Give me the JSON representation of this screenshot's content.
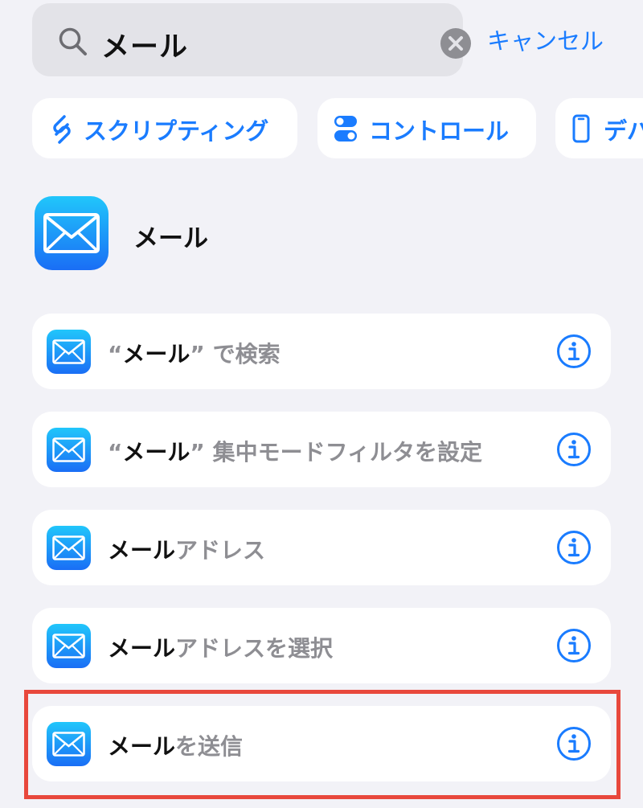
{
  "search": {
    "query": "メール",
    "cancel_label": "キャンセル"
  },
  "categories": [
    {
      "label": "スクリプティング",
      "icon": "scripting-icon"
    },
    {
      "label": "コントロール",
      "icon": "toggle-icon"
    },
    {
      "label": "デバ",
      "icon": "device-icon"
    }
  ],
  "app_header": {
    "title": "メール",
    "icon": "mail-app-icon"
  },
  "actions": [
    {
      "quote_open": "“",
      "strong": "メール",
      "quote_close": "”",
      "rest": " で検索"
    },
    {
      "quote_open": "“",
      "strong": "メール",
      "quote_close": "”",
      "rest": " 集中モードフィルタを設定"
    },
    {
      "quote_open": "",
      "strong": "メール",
      "quote_close": "",
      "rest": "アドレス"
    },
    {
      "quote_open": "",
      "strong": "メール",
      "quote_close": "",
      "rest": "アドレスを選択"
    },
    {
      "quote_open": "",
      "strong": "メール",
      "quote_close": "",
      "rest": "を送信"
    }
  ],
  "colors": {
    "accent": "#1a7cff",
    "background": "#f2f2f7",
    "highlight": "#e8483c"
  }
}
